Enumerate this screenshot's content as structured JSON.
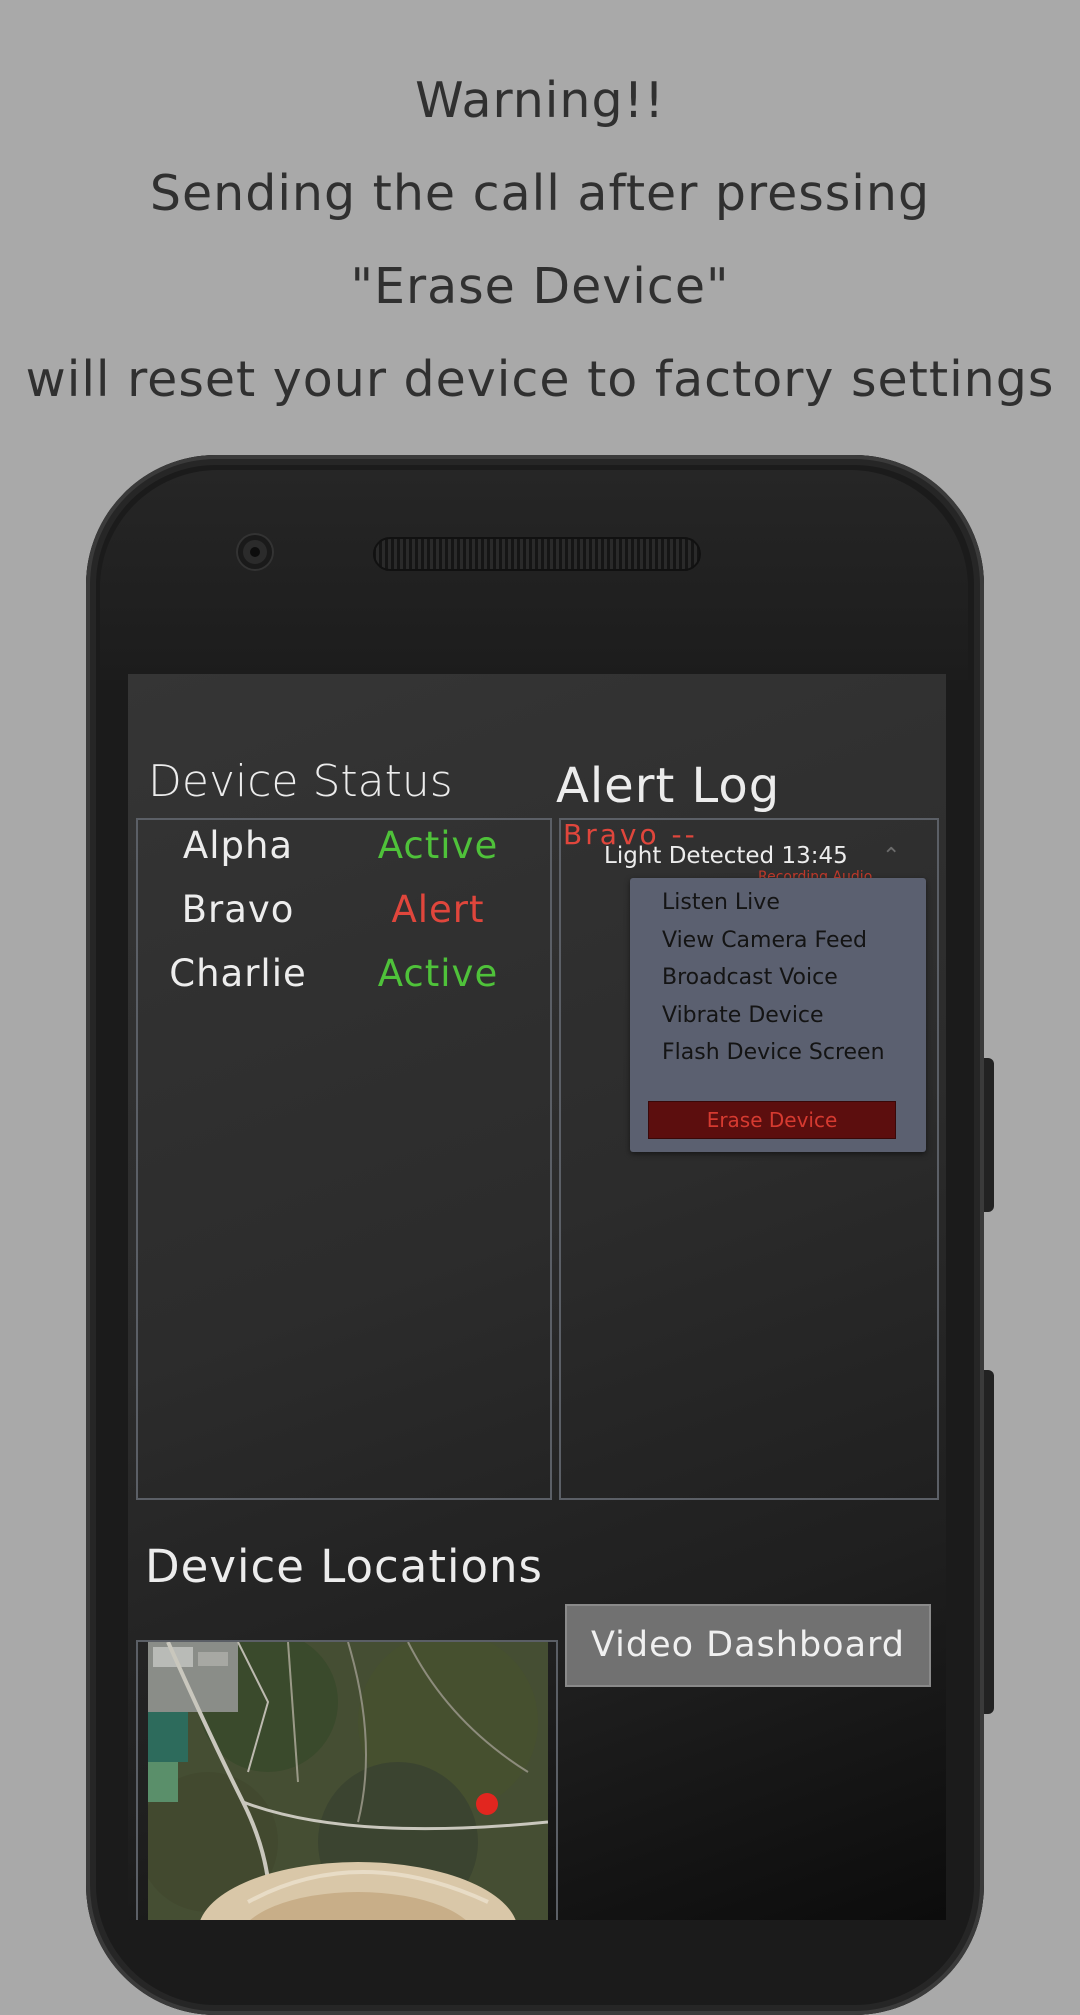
{
  "banner": {
    "line1": "Warning!!",
    "line2": "Sending the call after pressing",
    "line3": "\"Erase Device\"",
    "line4": "will reset your device to factory settings"
  },
  "device_status": {
    "title": "Device Status",
    "devices": [
      {
        "name": "Alpha",
        "status": "Active",
        "color": "#4fc23a"
      },
      {
        "name": "Bravo",
        "status": "Alert",
        "color": "#e0463c"
      },
      {
        "name": "Charlie",
        "status": "Active",
        "color": "#4fc23a"
      }
    ]
  },
  "alert_log": {
    "title": "Alert Log",
    "entry": {
      "device": "Bravo --",
      "message": "Light Detected 13:45",
      "sub": "Recording Audio"
    },
    "menu": {
      "items": [
        "Listen Live",
        "View Camera Feed",
        "Broadcast Voice",
        "Vibrate Device",
        "Flash Device Screen"
      ],
      "erase_label": "Erase Device"
    }
  },
  "locations": {
    "title": "Device Locations",
    "video_button": "Video Dashboard"
  },
  "colors": {
    "active": "#4fc23a",
    "alert": "#e0463c",
    "background": "#a9a9a9"
  }
}
